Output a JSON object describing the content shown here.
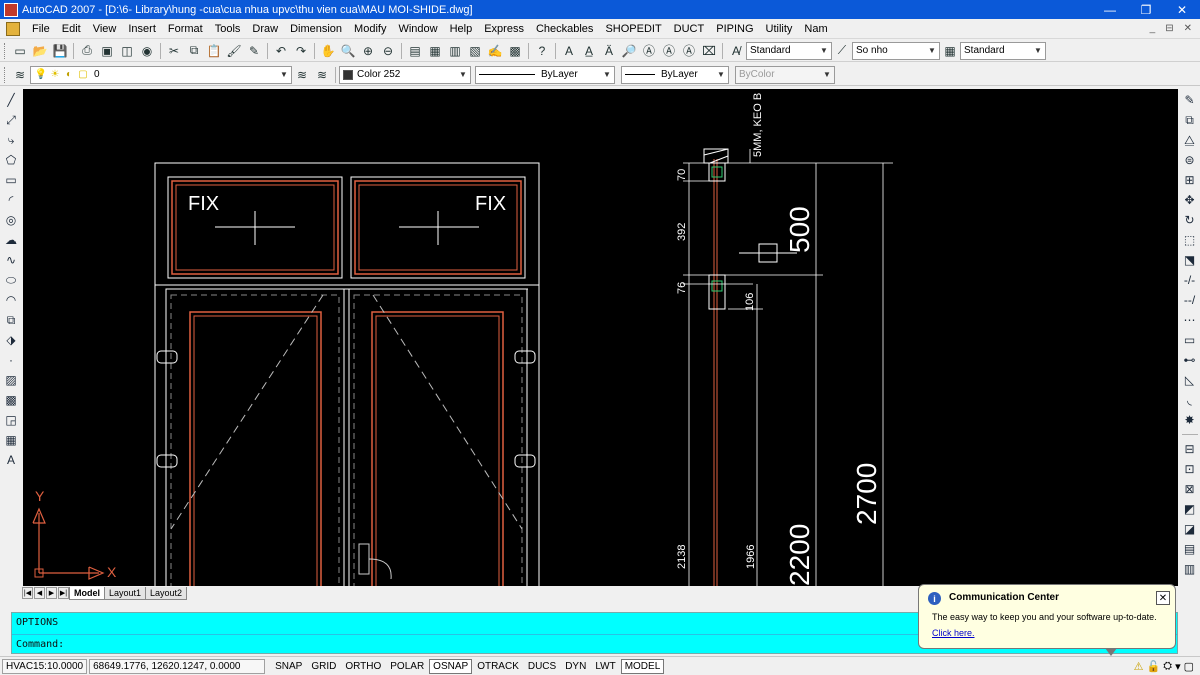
{
  "window": {
    "title": "AutoCAD 2007 - [D:\\6- Library\\hung -cua\\cua nhua upvc\\thu vien cua\\MAU MOI-SHIDE.dwg]",
    "minimize": "—",
    "maximize": "❐",
    "close": "✕"
  },
  "menu": {
    "items": [
      "File",
      "Edit",
      "View",
      "Insert",
      "Format",
      "Tools",
      "Draw",
      "Dimension",
      "Modify",
      "Window",
      "Help",
      "Express",
      "Checkables",
      "SHOPEDIT",
      "DUCT",
      "PIPING",
      "Utility",
      "Nam"
    ],
    "mdi": [
      "_",
      "⊟",
      "✕"
    ]
  },
  "toolbar1": {
    "text_style": "Standard",
    "dim_style": "So nho",
    "table_style": "Standard"
  },
  "toolbar2": {
    "layer": "0",
    "color": "Color 252",
    "linetype": "ByLayer",
    "lineweight": "ByLayer",
    "plotstyle": "ByColor"
  },
  "drawing": {
    "fix_label_left": "FIX",
    "fix_label_right": "FIX",
    "dim_vertical_note": "5MM, KEO B",
    "dim_70": "70",
    "dim_392": "392",
    "dim_76": "76",
    "dim_106": "106",
    "dim_2138": "2138",
    "dim_1966": "1966",
    "dim_500": "500",
    "dim_2200": "2200",
    "dim_2700": "2700",
    "ucs_y": "Y",
    "ucs_x": "X",
    "colors": {
      "frame": "#ffffff",
      "sash": "#e06040",
      "dim": "#ffffff"
    }
  },
  "tabs": {
    "items": [
      "Model",
      "Layout1",
      "Layout2"
    ],
    "active": "Model"
  },
  "command": {
    "history": "OPTIONS",
    "prompt": "Command:"
  },
  "status": {
    "units": "HVAC15:10.0000",
    "coords": "68649.1776, 12620.1247, 0.0000",
    "toggles": [
      "SNAP",
      "GRID",
      "ORTHO",
      "POLAR",
      "OSNAP",
      "OTRACK",
      "DUCS",
      "DYN",
      "LWT",
      "MODEL"
    ],
    "toggles_on": [
      "OSNAP",
      "MODEL"
    ]
  },
  "balloon": {
    "title": "Communication Center",
    "text": "The easy way to keep you and your software up-to-date.",
    "link": "Click here.",
    "close": "✕"
  }
}
